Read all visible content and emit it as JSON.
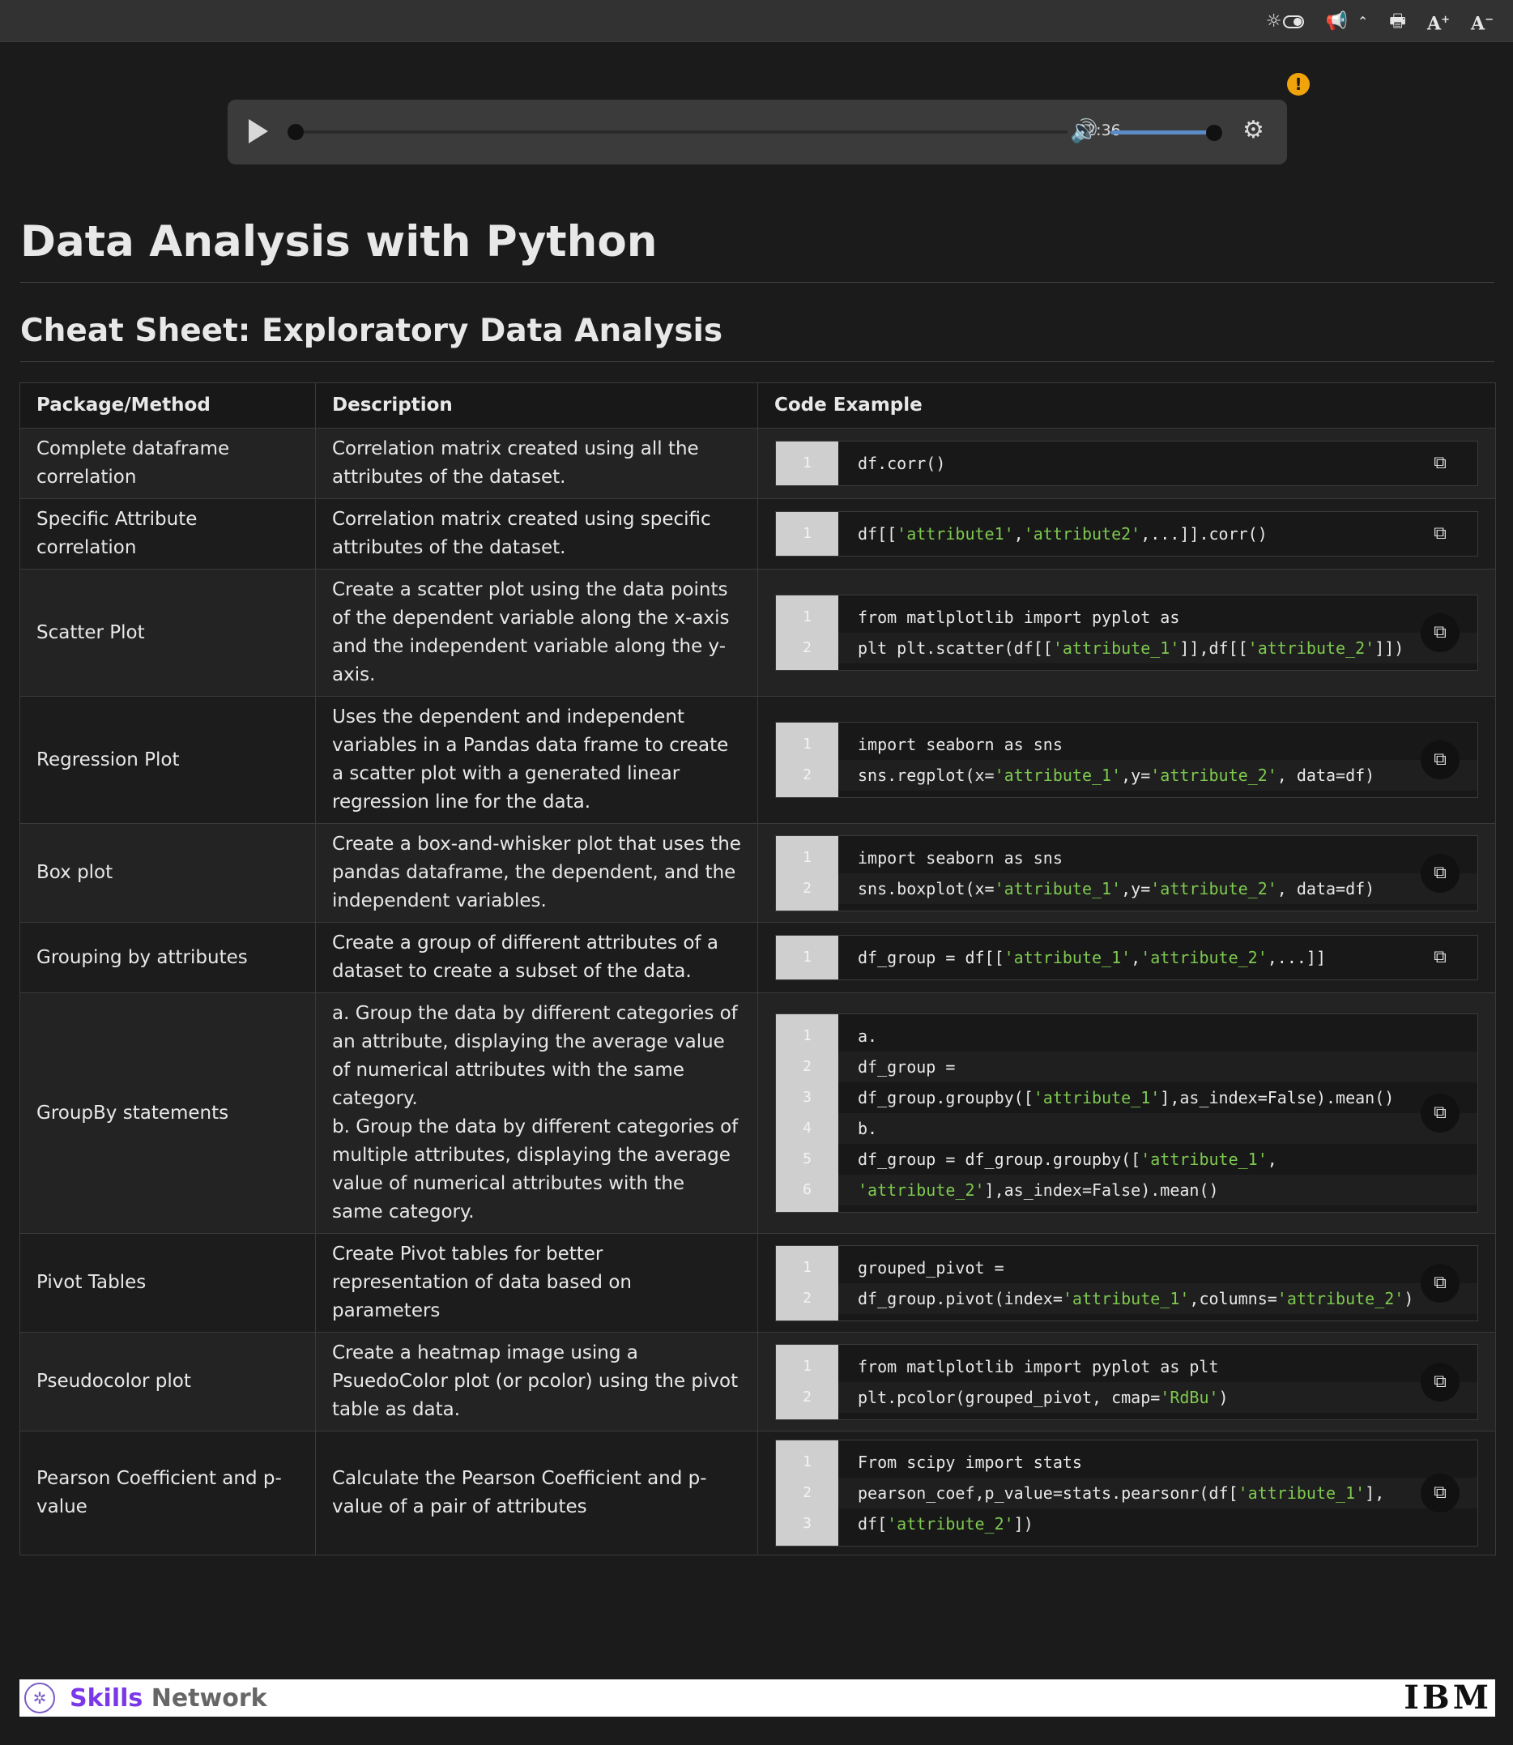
{
  "toolbar": {
    "icons": [
      "theme-toggle-icon",
      "announcement-icon",
      "collapse-icon",
      "print-icon",
      "font-increase-icon",
      "font-decrease-icon"
    ],
    "font_increase_label": "A",
    "font_decrease_label": "A"
  },
  "player": {
    "time": "02:36",
    "progress": 0.0,
    "volume": 1.0
  },
  "page": {
    "title": "Data Analysis with Python",
    "subtitle": "Cheat Sheet: Exploratory Data Analysis"
  },
  "table": {
    "headers": [
      "Package/Method",
      "Description",
      "Code Example"
    ],
    "rows": [
      {
        "method": "Complete dataframe correlation",
        "description": "Correlation matrix created using all the attributes of the dataset.",
        "code": [
          "df.corr()"
        ]
      },
      {
        "method": "Specific Attribute correlation",
        "description": "Correlation matrix created using specific attributes of the dataset.",
        "code": [
          "df[['attribute1','attribute2',...]].corr()"
        ]
      },
      {
        "method": "Scatter Plot",
        "description": "Create a scatter plot using the data points of the dependent variable along the x-axis and the independent variable along the y-axis.",
        "code": [
          "from matlplotlib import pyplot as",
          "plt plt.scatter(df[['attribute_1']],df[['attribute_2']])"
        ]
      },
      {
        "method": "Regression Plot",
        "description": "Uses the dependent and independent variables in a Pandas data frame to create a scatter plot with a generated linear regression line for the data.",
        "code": [
          "import seaborn as sns",
          "sns.regplot(x='attribute_1',y='attribute_2', data=df)"
        ]
      },
      {
        "method": "Box plot",
        "description": "Create a box-and-whisker plot that uses the pandas dataframe, the dependent, and the independent variables.",
        "code": [
          "import seaborn as sns",
          "sns.boxplot(x='attribute_1',y='attribute_2', data=df)"
        ]
      },
      {
        "method": "Grouping by attributes",
        "description": "Create a group of different attributes of a dataset to create a subset of the data.",
        "code": [
          "df_group = df[['attribute_1','attribute_2',...]]"
        ]
      },
      {
        "method": "GroupBy statements",
        "description": "a. Group the data by different categories of an attribute, displaying the average value of numerical attributes with the same category.\nb. Group the data by different categories of multiple attributes, displaying the average value of numerical attributes with the same category.",
        "code": [
          "a.",
          "df_group =",
          "df_group.groupby(['attribute_1'],as_index=False).mean()",
          "b.",
          "df_group = df_group.groupby(['attribute_1',",
          "'attribute_2'],as_index=False).mean()"
        ]
      },
      {
        "method": "Pivot Tables",
        "description": "Create Pivot tables for better representation of data based on parameters",
        "code": [
          "grouped_pivot =",
          "df_group.pivot(index='attribute_1',columns='attribute_2')"
        ]
      },
      {
        "method": "Pseudocolor plot",
        "description": "Create a heatmap image using a PsuedoColor plot (or pcolor) using the pivot table as data.",
        "code": [
          "from matlplotlib import pyplot as plt",
          "plt.pcolor(grouped_pivot, cmap='RdBu')"
        ]
      },
      {
        "method": "Pearson Coefficient and p-value",
        "description": "Calculate the Pearson Coefficient and p-value of a pair of attributes",
        "code": [
          "From scipy import stats",
          "pearson_coef,p_value=stats.pearsonr(df['attribute_1'],",
          "df['attribute_2'])"
        ]
      }
    ]
  },
  "footer": {
    "brand_strong": "Skills",
    "brand_rest": " Network",
    "partner": "IBM"
  },
  "colors": {
    "string": "#7ec94f",
    "accent_purple": "#7b38e8",
    "alert": "#f0a30a"
  }
}
